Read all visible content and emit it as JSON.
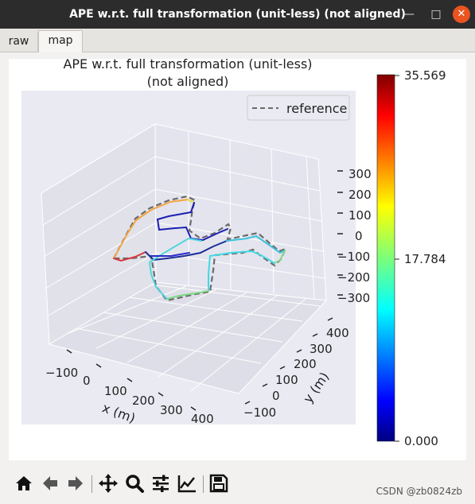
{
  "window": {
    "title": "APE w.r.t. full transformation (unit-less) (not aligned)"
  },
  "tabs": [
    {
      "label": "raw"
    },
    {
      "label": "map"
    }
  ],
  "plot": {
    "title_line1": "APE w.r.t. full transformation (unit-less)",
    "title_line2": "(not aligned)",
    "legend_label": "reference",
    "x_label": "x (m)",
    "y_label": "y (m)",
    "x_ticks": [
      "−100",
      "0",
      "100",
      "200",
      "300",
      "400"
    ],
    "y_ticks": [
      "−100",
      "0",
      "100",
      "200",
      "300",
      "400"
    ],
    "z_ticks": [
      "300",
      "200",
      "100",
      "0",
      "−100",
      "−200",
      "−300"
    ]
  },
  "colorbar": {
    "max_label": "35.569",
    "mid_label": "17.784",
    "min_label": "0.000",
    "colormap": "jet"
  },
  "toolbar": {
    "buttons": [
      "home-icon",
      "back-icon",
      "forward-icon",
      "pan-icon",
      "zoom-icon",
      "configure-subplots-icon",
      "edit-axis-icon",
      "save-icon"
    ]
  },
  "watermark": "CSDN @zb0824zb"
}
